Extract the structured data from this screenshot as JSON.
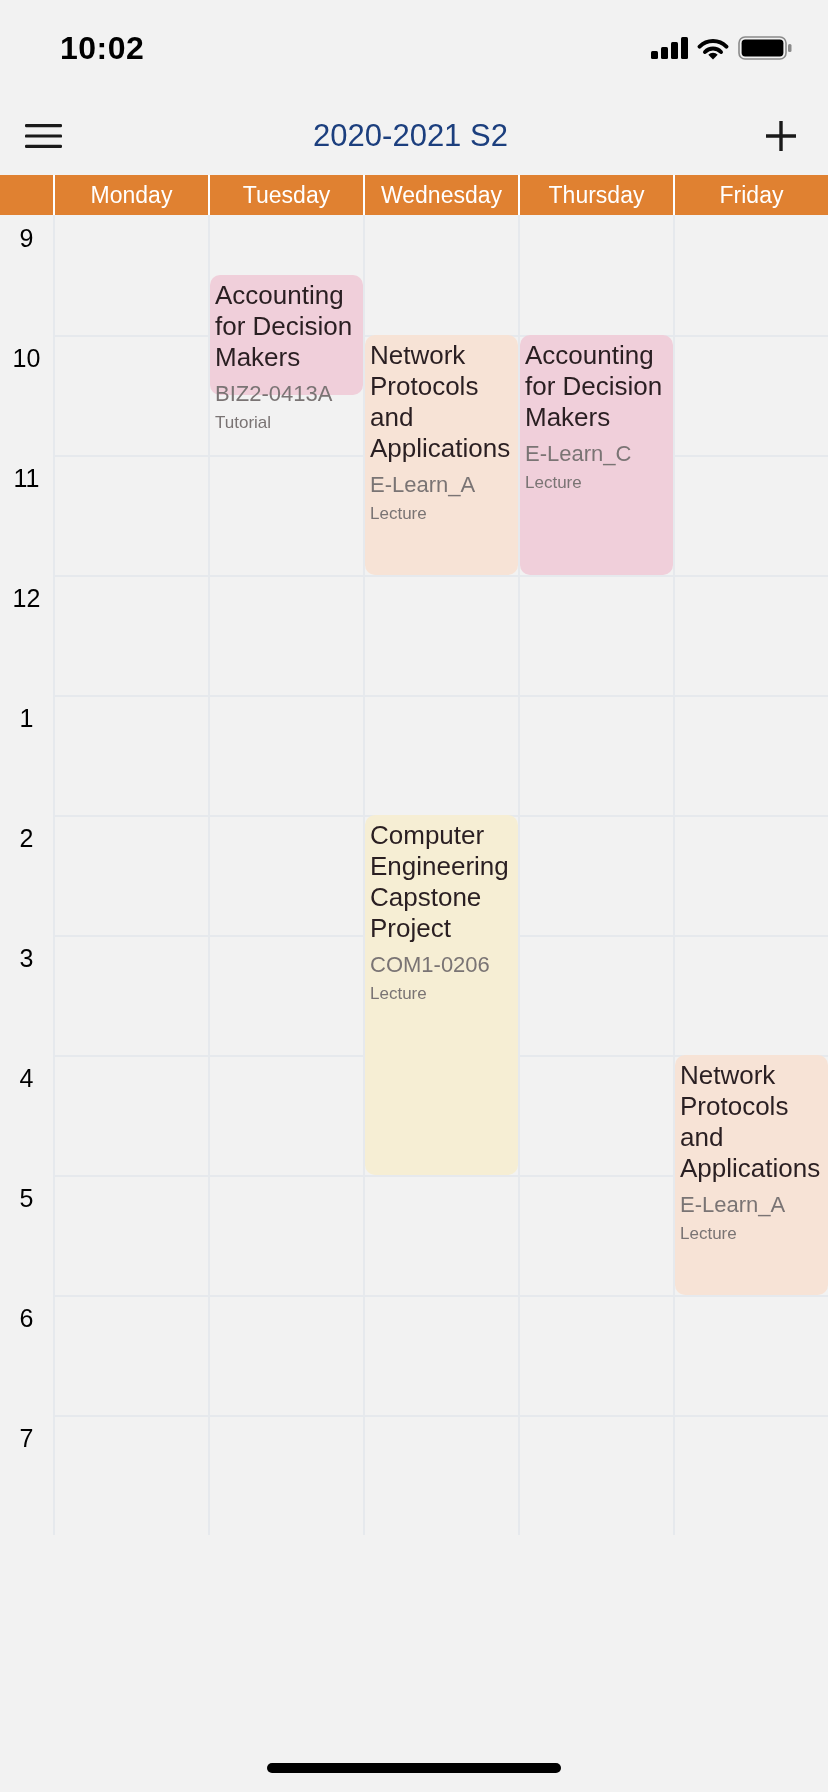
{
  "status_bar": {
    "time": "10:02"
  },
  "nav_bar": {
    "title": "2020-2021 S2"
  },
  "hours": [
    "9",
    "10",
    "11",
    "12",
    "1",
    "2",
    "3",
    "4",
    "5",
    "6",
    "7"
  ],
  "days": [
    {
      "label": "Monday"
    },
    {
      "label": "Tuesday",
      "timeline": [
        {
          "kind": "free"
        },
        {
          "kind": "class",
          "title": "Accounting for Decision Makers",
          "room": "BIZ2-0413A",
          "type": "Tutorial",
          "color": "#f0cfda"
        },
        {
          "kind": "continued"
        }
      ]
    },
    {
      "label": "Wednesday",
      "timeline": [
        {
          "kind": "free"
        },
        {
          "kind": "free"
        },
        {
          "kind": "class",
          "title": "Network Protocols and Applications",
          "room": "E-Learn_A",
          "type": "Lecture",
          "color": "#f7e3d6"
        },
        {
          "kind": "continued"
        },
        {
          "kind": "continued"
        },
        {
          "kind": "continued"
        },
        {
          "kind": "free"
        },
        {
          "kind": "free"
        },
        {
          "kind": "free"
        },
        {
          "kind": "free"
        },
        {
          "kind": "class",
          "title": "Computer Engineering Capstone Project",
          "room": "COM1-0206",
          "type": "Lecture",
          "color": "#f6eed4"
        },
        {
          "kind": "continued"
        },
        {
          "kind": "continued"
        },
        {
          "kind": "continued"
        },
        {
          "kind": "continued"
        },
        {
          "kind": "continued"
        }
      ]
    },
    {
      "label": "Thursday",
      "timeline": [
        {
          "kind": "free"
        },
        {
          "kind": "free"
        },
        {
          "kind": "class",
          "title": "Accounting for Decision Makers",
          "room": "E-Learn_C",
          "type": "Lecture",
          "color": "#f0cfda"
        },
        {
          "kind": "continued"
        },
        {
          "kind": "continued"
        },
        {
          "kind": "continued"
        }
      ]
    },
    {
      "label": "Friday",
      "timeline": [
        {
          "kind": "free"
        },
        {
          "kind": "free"
        },
        {
          "kind": "free"
        },
        {
          "kind": "free"
        },
        {
          "kind": "free"
        },
        {
          "kind": "free"
        },
        {
          "kind": "free"
        },
        {
          "kind": "free"
        },
        {
          "kind": "free"
        },
        {
          "kind": "free"
        },
        {
          "kind": "free"
        },
        {
          "kind": "free"
        },
        {
          "kind": "free"
        },
        {
          "kind": "free"
        },
        {
          "kind": "class",
          "title": "Network Protocols and Applications",
          "room": "E-Learn_A",
          "type": "Lecture",
          "color": "#f7e3d6"
        },
        {
          "kind": "continued"
        },
        {
          "kind": "continued"
        },
        {
          "kind": "continued"
        }
      ]
    }
  ]
}
